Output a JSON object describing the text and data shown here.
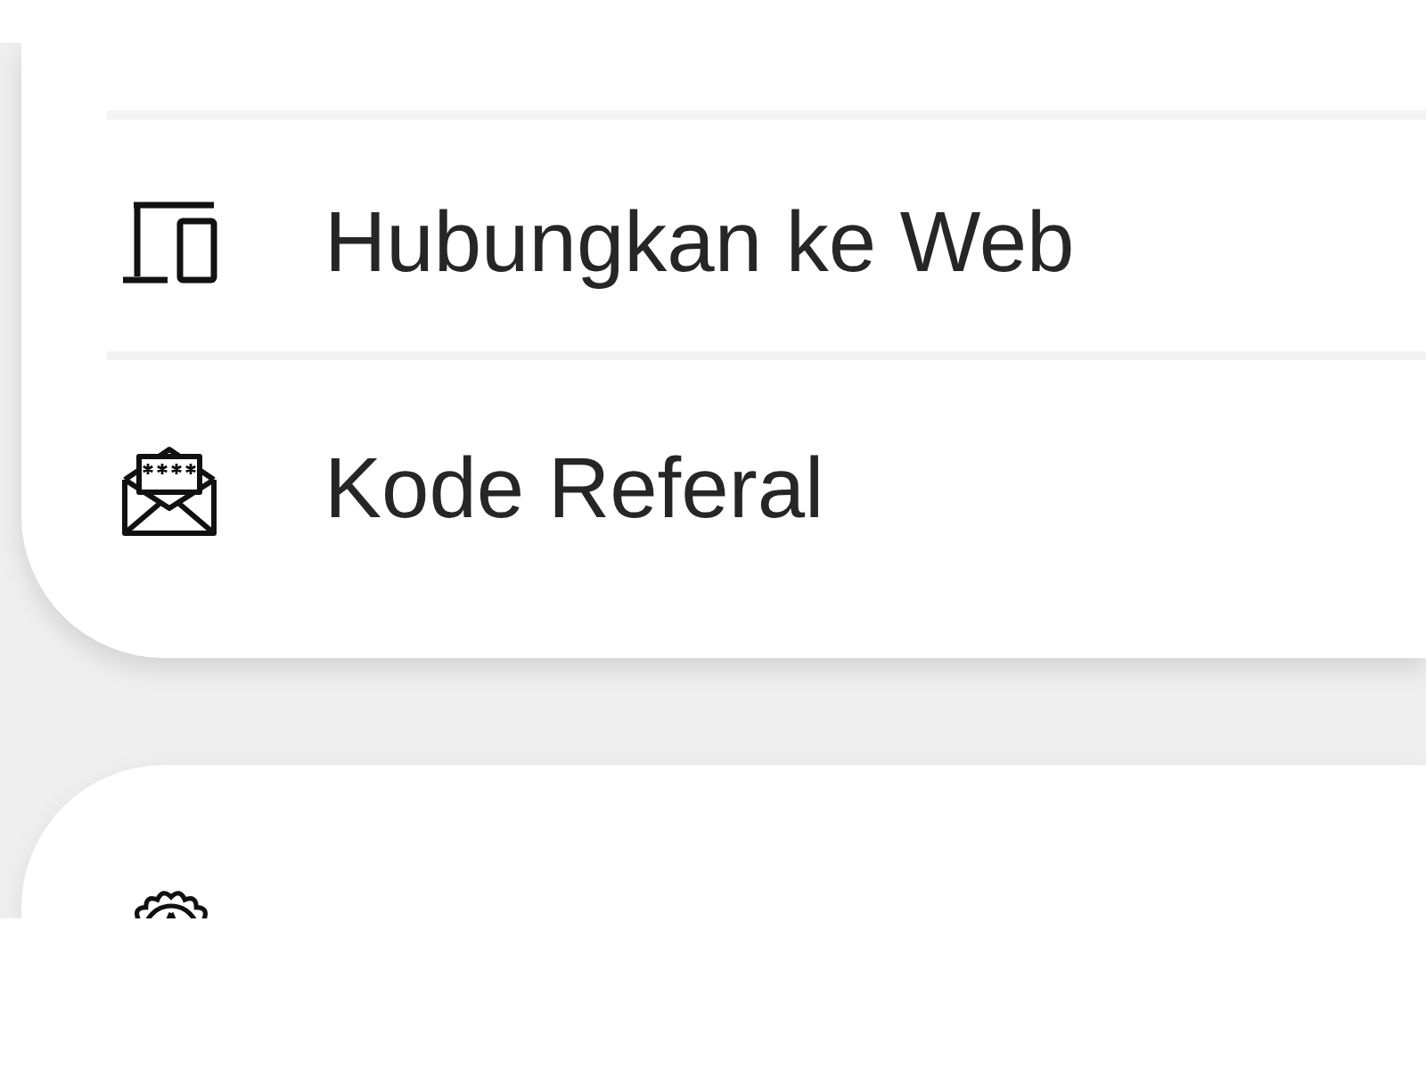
{
  "sections": [
    {
      "items": [
        {
          "label": "Hubungkan ke Web",
          "cut_off": false
        },
        {
          "label": "Kode Referal",
          "cut_off": false
        }
      ]
    },
    {
      "items": [
        {
          "cut_off": true
        }
      ]
    }
  ]
}
